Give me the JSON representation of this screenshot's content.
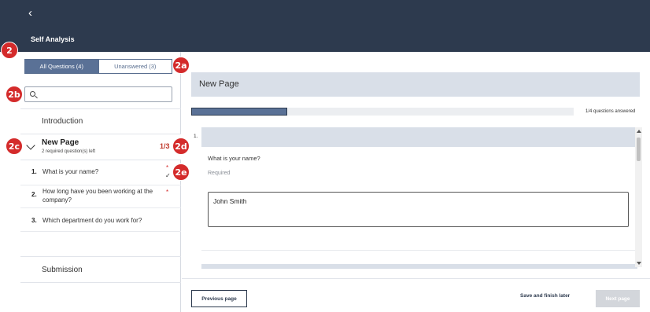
{
  "header": {
    "back_icon": "chevron-left-icon",
    "title": "Self Analysis",
    "background": "#2d3a4e"
  },
  "badges": {
    "b2": "2",
    "b2a": "2a",
    "b2b": "2b",
    "b2c": "2c",
    "b2d": "2d",
    "b2e": "2e",
    "color": "#d42b2b"
  },
  "left": {
    "tabs": {
      "all": "All Questions (4)",
      "unanswered": "Unanswered (3)"
    },
    "search": {
      "placeholder": "",
      "value": ""
    },
    "sections": {
      "introduction": "Introduction",
      "submission": "Submission"
    },
    "page_node": {
      "title": "New Page",
      "subtitle": "2 required question(s) left",
      "count": "1/3"
    },
    "questions": [
      {
        "num": "1.",
        "text": "What is your name?",
        "required": "*",
        "status": "✓"
      },
      {
        "num": "2.",
        "text": "How long have you been working at the company?",
        "required": "*"
      },
      {
        "num": "3.",
        "text": "Which department do you work for?"
      }
    ]
  },
  "right": {
    "page_title": "New Page",
    "progress": {
      "label": "1/4 questions answered",
      "fraction": 0.25,
      "color": "#5a7196"
    },
    "question": {
      "num": "1.",
      "title": "What is your name?",
      "required_label": "Required",
      "answer": "John Smith"
    },
    "buttons": {
      "previous": "Previous page",
      "save": "Save and finish later",
      "next": "Next page"
    }
  }
}
